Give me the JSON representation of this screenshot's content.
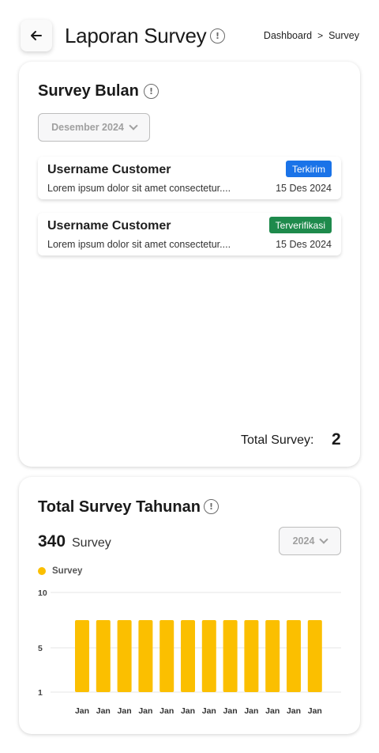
{
  "header": {
    "title": "Laporan Survey",
    "breadcrumb": [
      "Dashboard",
      ">",
      "Survey"
    ]
  },
  "monthly": {
    "title": "Survey Bulan",
    "month_select": "Desember 2024",
    "items": [
      {
        "name": "Username Customer",
        "desc": "Lorem ipsum dolor sit amet consectetur....",
        "date": "15 Des 2024",
        "status": "Terkirim"
      },
      {
        "name": "Username Customer",
        "desc": "Lorem ipsum dolor sit amet consectetur....",
        "date": "15 Des 2024",
        "status": "Terverifikasi"
      }
    ],
    "total_label": "Total Survey:",
    "total_value": "2"
  },
  "yearly": {
    "title": "Total Survey Tahunan",
    "count": "340",
    "count_unit": "Survey",
    "year_select": "2024"
  },
  "colors": {
    "bar": "#fbbf00",
    "badge_blue": "#1a73e8",
    "badge_green": "#1e8a4c"
  },
  "chart_data": {
    "type": "bar",
    "categories": [
      "Jan",
      "Jan",
      "Jan",
      "Jan",
      "Jan",
      "Jan",
      "Jan",
      "Jan",
      "Jan",
      "Jan",
      "Jan",
      "Jan"
    ],
    "series": [
      {
        "name": "Survey",
        "values": [
          7.5,
          7.5,
          7.5,
          7.5,
          7.5,
          7.5,
          7.5,
          7.5,
          7.5,
          7.5,
          7.5,
          7.5
        ]
      }
    ],
    "yticks": [
      "10",
      "5",
      "1"
    ],
    "ylim": [
      1,
      10
    ],
    "grid": true,
    "legend": "top-left"
  }
}
